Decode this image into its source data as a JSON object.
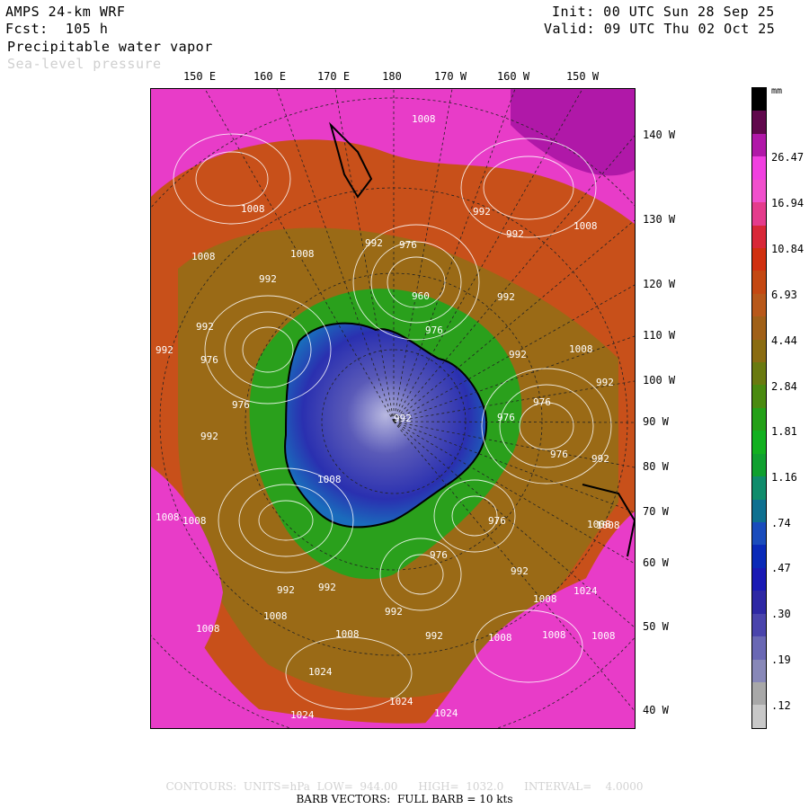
{
  "header": {
    "model": "AMPS 24-km WRF",
    "forecast": "Fcst:  105 h",
    "field_primary": "Precipitable water vapor",
    "field_secondary": "Sea-level pressure",
    "init": "Init: 00 UTC Sun 28 Sep 25",
    "valid": "Valid: 09 UTC Thu 02 Oct 25"
  },
  "top_longitudes": [
    "150 E",
    "160 E",
    "170 E",
    "180",
    "170 W",
    "160 W",
    "150 W"
  ],
  "right_longitudes": [
    "140 W",
    "130 W",
    "120 W",
    "110 W",
    "100 W",
    "90 W",
    "80 W",
    "70 W",
    "60 W",
    "50 W",
    "40 W"
  ],
  "pressure_labels": [
    "1008",
    "1008",
    "992",
    "992",
    "976",
    "960",
    "1008",
    "992",
    "1008",
    "1008",
    "992",
    "992",
    "992",
    "976",
    "992",
    "1008",
    "976",
    "992",
    "992",
    "976",
    "976",
    "992",
    "976",
    "992",
    "1008",
    "976",
    "1008",
    "976",
    "992",
    "1008",
    "1008",
    "992",
    "992",
    "1008",
    "1008",
    "1024",
    "1008",
    "976",
    "992",
    "1008",
    "1024",
    "1008",
    "1008",
    "992",
    "1024",
    "1024",
    "992",
    "1008",
    "1008",
    "1024"
  ],
  "colorbar": {
    "units": "mm",
    "colors": [
      "#c8c8c8",
      "#a8a8a8",
      "#8888b8",
      "#6a68b4",
      "#4a44ac",
      "#2e28a4",
      "#1a1ab4",
      "#0a2ab8",
      "#1a4cbc",
      "#0e7090",
      "#108c6c",
      "#10a030",
      "#12b020",
      "#24a018",
      "#4a8a10",
      "#6a7a10",
      "#8a6c12",
      "#a06018",
      "#b8581a",
      "#c44812",
      "#d03010",
      "#d82838",
      "#e43c8c",
      "#f050cc",
      "#f040e0",
      "#b018a8",
      "#60084c",
      "#000000"
    ],
    "tick_labels": [
      ".12",
      ".19",
      ".30",
      ".47",
      ".74",
      "1.16",
      "1.81",
      "2.84",
      "4.44",
      "6.93",
      "10.84",
      "16.94",
      "26.47"
    ]
  },
  "footer": {
    "contours": "CONTOURS:  UNITS=hPa  LOW=  944.00      HIGH=  1032.0      INTERVAL=    4.0000",
    "barbs": "BARB VECTORS:  FULL BARB = 10 kts"
  }
}
